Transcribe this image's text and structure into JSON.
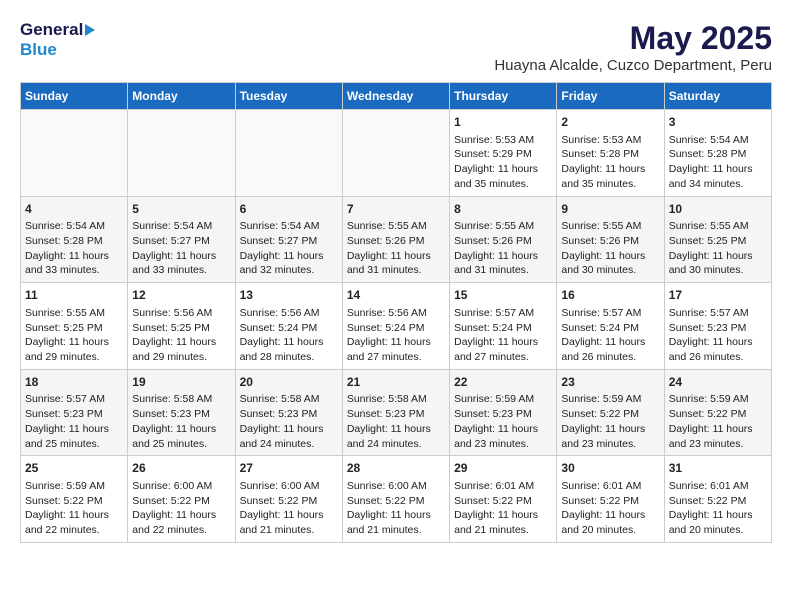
{
  "header": {
    "logo_general": "General",
    "logo_blue": "Blue",
    "title": "May 2025",
    "subtitle": "Huayna Alcalde, Cuzco Department, Peru"
  },
  "days_of_week": [
    "Sunday",
    "Monday",
    "Tuesday",
    "Wednesday",
    "Thursday",
    "Friday",
    "Saturday"
  ],
  "weeks": [
    [
      {
        "day": "",
        "info": ""
      },
      {
        "day": "",
        "info": ""
      },
      {
        "day": "",
        "info": ""
      },
      {
        "day": "",
        "info": ""
      },
      {
        "day": "1",
        "info": "Sunrise: 5:53 AM\nSunset: 5:29 PM\nDaylight: 11 hours\nand 35 minutes."
      },
      {
        "day": "2",
        "info": "Sunrise: 5:53 AM\nSunset: 5:28 PM\nDaylight: 11 hours\nand 35 minutes."
      },
      {
        "day": "3",
        "info": "Sunrise: 5:54 AM\nSunset: 5:28 PM\nDaylight: 11 hours\nand 34 minutes."
      }
    ],
    [
      {
        "day": "4",
        "info": "Sunrise: 5:54 AM\nSunset: 5:28 PM\nDaylight: 11 hours\nand 33 minutes."
      },
      {
        "day": "5",
        "info": "Sunrise: 5:54 AM\nSunset: 5:27 PM\nDaylight: 11 hours\nand 33 minutes."
      },
      {
        "day": "6",
        "info": "Sunrise: 5:54 AM\nSunset: 5:27 PM\nDaylight: 11 hours\nand 32 minutes."
      },
      {
        "day": "7",
        "info": "Sunrise: 5:55 AM\nSunset: 5:26 PM\nDaylight: 11 hours\nand 31 minutes."
      },
      {
        "day": "8",
        "info": "Sunrise: 5:55 AM\nSunset: 5:26 PM\nDaylight: 11 hours\nand 31 minutes."
      },
      {
        "day": "9",
        "info": "Sunrise: 5:55 AM\nSunset: 5:26 PM\nDaylight: 11 hours\nand 30 minutes."
      },
      {
        "day": "10",
        "info": "Sunrise: 5:55 AM\nSunset: 5:25 PM\nDaylight: 11 hours\nand 30 minutes."
      }
    ],
    [
      {
        "day": "11",
        "info": "Sunrise: 5:55 AM\nSunset: 5:25 PM\nDaylight: 11 hours\nand 29 minutes."
      },
      {
        "day": "12",
        "info": "Sunrise: 5:56 AM\nSunset: 5:25 PM\nDaylight: 11 hours\nand 29 minutes."
      },
      {
        "day": "13",
        "info": "Sunrise: 5:56 AM\nSunset: 5:24 PM\nDaylight: 11 hours\nand 28 minutes."
      },
      {
        "day": "14",
        "info": "Sunrise: 5:56 AM\nSunset: 5:24 PM\nDaylight: 11 hours\nand 27 minutes."
      },
      {
        "day": "15",
        "info": "Sunrise: 5:57 AM\nSunset: 5:24 PM\nDaylight: 11 hours\nand 27 minutes."
      },
      {
        "day": "16",
        "info": "Sunrise: 5:57 AM\nSunset: 5:24 PM\nDaylight: 11 hours\nand 26 minutes."
      },
      {
        "day": "17",
        "info": "Sunrise: 5:57 AM\nSunset: 5:23 PM\nDaylight: 11 hours\nand 26 minutes."
      }
    ],
    [
      {
        "day": "18",
        "info": "Sunrise: 5:57 AM\nSunset: 5:23 PM\nDaylight: 11 hours\nand 25 minutes."
      },
      {
        "day": "19",
        "info": "Sunrise: 5:58 AM\nSunset: 5:23 PM\nDaylight: 11 hours\nand 25 minutes."
      },
      {
        "day": "20",
        "info": "Sunrise: 5:58 AM\nSunset: 5:23 PM\nDaylight: 11 hours\nand 24 minutes."
      },
      {
        "day": "21",
        "info": "Sunrise: 5:58 AM\nSunset: 5:23 PM\nDaylight: 11 hours\nand 24 minutes."
      },
      {
        "day": "22",
        "info": "Sunrise: 5:59 AM\nSunset: 5:23 PM\nDaylight: 11 hours\nand 23 minutes."
      },
      {
        "day": "23",
        "info": "Sunrise: 5:59 AM\nSunset: 5:22 PM\nDaylight: 11 hours\nand 23 minutes."
      },
      {
        "day": "24",
        "info": "Sunrise: 5:59 AM\nSunset: 5:22 PM\nDaylight: 11 hours\nand 23 minutes."
      }
    ],
    [
      {
        "day": "25",
        "info": "Sunrise: 5:59 AM\nSunset: 5:22 PM\nDaylight: 11 hours\nand 22 minutes."
      },
      {
        "day": "26",
        "info": "Sunrise: 6:00 AM\nSunset: 5:22 PM\nDaylight: 11 hours\nand 22 minutes."
      },
      {
        "day": "27",
        "info": "Sunrise: 6:00 AM\nSunset: 5:22 PM\nDaylight: 11 hours\nand 21 minutes."
      },
      {
        "day": "28",
        "info": "Sunrise: 6:00 AM\nSunset: 5:22 PM\nDaylight: 11 hours\nand 21 minutes."
      },
      {
        "day": "29",
        "info": "Sunrise: 6:01 AM\nSunset: 5:22 PM\nDaylight: 11 hours\nand 21 minutes."
      },
      {
        "day": "30",
        "info": "Sunrise: 6:01 AM\nSunset: 5:22 PM\nDaylight: 11 hours\nand 20 minutes."
      },
      {
        "day": "31",
        "info": "Sunrise: 6:01 AM\nSunset: 5:22 PM\nDaylight: 11 hours\nand 20 minutes."
      }
    ]
  ]
}
